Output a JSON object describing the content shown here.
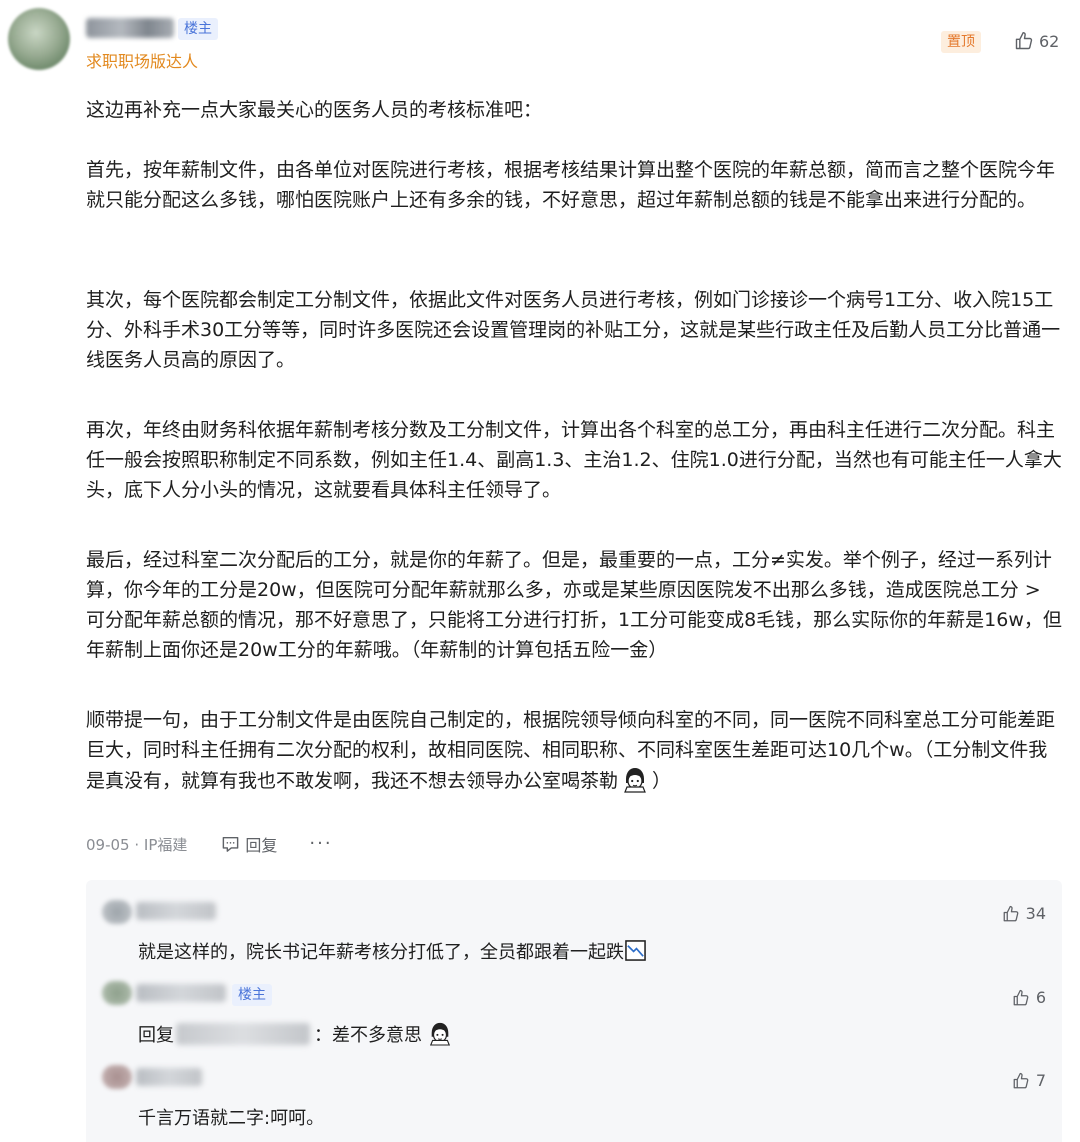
{
  "post": {
    "op_badge": "楼主",
    "user_title": "求职职场版达人",
    "pinned_label": "置顶",
    "like_count": "62",
    "paragraphs": [
      "这边再补充一点大家最关心的医务人员的考核标准吧：",
      "首先，按年薪制文件，由各单位对医院进行考核，根据考核结果计算出整个医院的年薪总额，简而言之整个医院今年就只能分配这么多钱，哪怕医院账户上还有多余的钱，不好意思，超过年薪制总额的钱是不能拿出来进行分配的。",
      "其次，每个医院都会制定工分制文件，依据此文件对医务人员进行考核，例如门诊接诊一个病号1工分、收入院15工分、外科手术30工分等等，同时许多医院还会设置管理岗的补贴工分，这就是某些行政主任及后勤人员工分比普通一线医务人员高的原因了。",
      "再次，年终由财务科依据年薪制考核分数及工分制文件，计算出各个科室的总工分，再由科主任进行二次分配。科主任一般会按照职称制定不同系数，例如主任1.4、副高1.3、主治1.2、住院1.0进行分配，当然也有可能主任一人拿大头，底下人分小头的情况，这就要看具体科主任领导了。",
      "最后，经过科室二次分配后的工分，就是你的年薪了。但是，最重要的一点，工分≠实发。举个例子，经过一系列计算，你今年的工分是20w，但医院可分配年薪就那么多，亦或是某些原因医院发不出那么多钱，造成医院总工分 > 可分配年薪总额的情况，那不好意思了，只能将工分进行打折，1工分可能变成8毛钱，那么实际你的年薪是16w，但年薪制上面你还是20w工分的年薪哦。（年薪制的计算包括五险一金）",
      "顺带提一句，由于工分制文件是由医院自己制定的，根据院领导倾向科室的不同，同一医院不同科室总工分可能差距巨大，同时科主任拥有二次分配的权利，故相同医院、相同职称、不同科室医生差距可达10几个w。（工分制文件我是真没有，就算有我也不敢发啊，我还不想去领导办公室喝茶勒",
      "）"
    ],
    "meta": {
      "date_location": "09-05 · IP福建",
      "reply_label": "回复",
      "more_label": "···"
    }
  },
  "comments": [
    {
      "text": "就是这样的，院长书记年薪考核分打低了，全员都跟着一起跌",
      "like_count": "34",
      "is_op": false
    },
    {
      "op_badge": "楼主",
      "reply_prefix": "回复",
      "reply_suffix": "：差不多意思",
      "like_count": "6",
      "is_op": true
    },
    {
      "text": "千言万语就二字:呵呵。",
      "like_count": "7",
      "is_op": false
    }
  ],
  "icons": {
    "like": "thumbs-up-icon",
    "reply": "comment-bubble-icon",
    "emoji": "girl-face-emoji-icon",
    "trend_down": "chart-down-emoji-icon"
  },
  "colors": {
    "op_badge_text": "#4a74d9",
    "op_badge_bg": "#eaf0fd",
    "user_title": "#e2891f",
    "pinned_text": "#e4792d",
    "pinned_bg": "#fdeede",
    "meta_text": "#8a8d93",
    "sub_bg": "#f6f7f9"
  }
}
